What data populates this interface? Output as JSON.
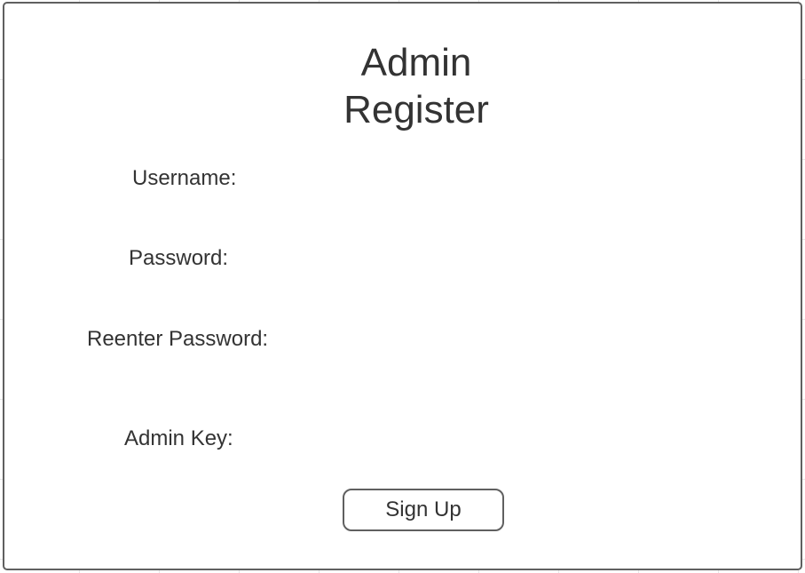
{
  "form": {
    "title_line1": "Admin",
    "title_line2": "Register",
    "fields": [
      {
        "label": "Username:",
        "value": ""
      },
      {
        "label": "Password:",
        "value": ""
      },
      {
        "label": "Reenter Password:",
        "value": ""
      },
      {
        "label": "Admin Key:",
        "value": ""
      }
    ],
    "submit_label": "Sign Up"
  }
}
